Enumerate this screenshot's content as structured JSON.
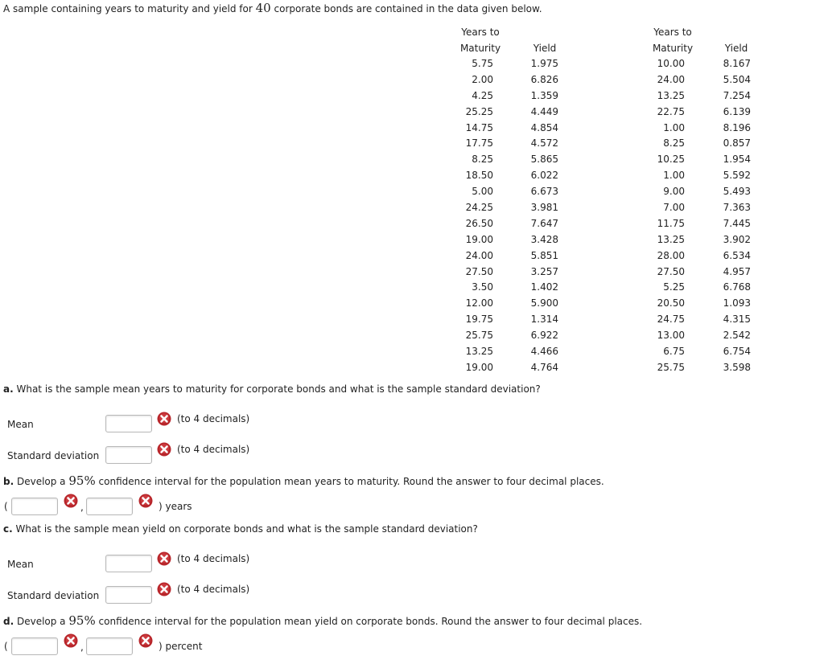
{
  "intro": {
    "before": "A sample containing years to maturity and yield for ",
    "count": "40",
    "after": " corporate bonds are contained in the data given below."
  },
  "table": {
    "headers": {
      "maturity_line1": "Years to",
      "maturity_line2": "Maturity",
      "yield": "Yield"
    },
    "left": {
      "maturity": [
        "5.75",
        "2.00",
        "4.25",
        "25.25",
        "14.75",
        "17.75",
        "8.25",
        "18.50",
        "5.00",
        "24.25",
        "26.50",
        "19.00",
        "24.00",
        "27.50",
        "3.50",
        "12.00",
        "19.75",
        "25.75",
        "13.25",
        "19.00"
      ],
      "yield": [
        "1.975",
        "6.826",
        "1.359",
        "4.449",
        "4.854",
        "4.572",
        "5.865",
        "6.022",
        "6.673",
        "3.981",
        "7.647",
        "3.428",
        "5.851",
        "3.257",
        "1.402",
        "5.900",
        "1.314",
        "6.922",
        "4.466",
        "4.764"
      ]
    },
    "right": {
      "maturity": [
        "10.00",
        "24.00",
        "13.25",
        "22.75",
        "1.00",
        "8.25",
        "10.25",
        "1.00",
        "9.00",
        "7.00",
        "11.75",
        "13.25",
        "28.00",
        "27.50",
        "5.25",
        "20.50",
        "24.75",
        "13.00",
        "6.75",
        "25.75"
      ],
      "yield": [
        "8.167",
        "5.504",
        "7.254",
        "6.139",
        "8.196",
        "0.857",
        "1.954",
        "5.592",
        "5.493",
        "7.363",
        "7.445",
        "3.902",
        "6.534",
        "4.957",
        "6.768",
        "1.093",
        "4.315",
        "2.542",
        "6.754",
        "3.598"
      ]
    }
  },
  "part_a": {
    "letter": "a.",
    "question": " What is the sample mean years to maturity for corporate bonds and what is the sample standard deviation?",
    "mean_label": "Mean",
    "mean_value": "",
    "mean_note": "(to 4 decimals)",
    "sd_label": "Standard deviation",
    "sd_value": "",
    "sd_note": "(to 4 decimals)"
  },
  "part_b": {
    "letter": "b.",
    "q_before": " Develop a ",
    "pct": "95%",
    "q_after": " confidence interval for the population mean years to maturity. Round the answer to four decimal places.",
    "open_paren": "(",
    "comma": ",",
    "close": ") years",
    "lower_value": "",
    "upper_value": ""
  },
  "part_c": {
    "letter": "c.",
    "question": " What is the sample mean yield on corporate bonds and what is the sample standard deviation?",
    "mean_label": "Mean",
    "mean_value": "",
    "mean_note": "(to 4 decimals)",
    "sd_label": "Standard deviation",
    "sd_value": "",
    "sd_note": "(to 4 decimals)"
  },
  "part_d": {
    "letter": "d.",
    "q_before": " Develop a ",
    "pct": "95%",
    "q_after": " confidence interval for the population mean yield on corporate bonds. Round the answer to four decimal places.",
    "open_paren": "(",
    "comma": ",",
    "close": ") percent",
    "lower_value": "",
    "upper_value": ""
  },
  "icons": {
    "incorrect": "x-circle-icon",
    "incorrect_color": "#c0282d"
  }
}
